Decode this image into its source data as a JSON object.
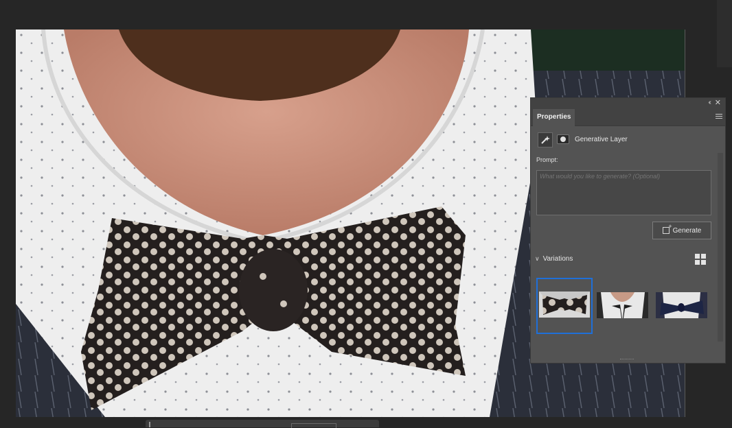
{
  "panel": {
    "tab_label": "Properties",
    "layer_name": "Generative Layer",
    "prompt_label": "Prompt:",
    "prompt_placeholder": "What would you like to generate? (Optional)",
    "generate_label": "Generate",
    "variations_label": "Variations",
    "selected_variation": 1,
    "variations_count": 3
  },
  "icons": {
    "collapse": "double-chevron-left-icon",
    "close": "close-icon",
    "menu": "hamburger-menu-icon",
    "generative": "generative-layer-icon",
    "mask": "layer-mask-icon",
    "generate": "generate-icon",
    "chevron": "chevron-down-icon",
    "grid": "grid-view-icon"
  },
  "colors": {
    "app_bg": "#262626",
    "panel_bg": "#535353",
    "selection": "#1f6fd8"
  }
}
